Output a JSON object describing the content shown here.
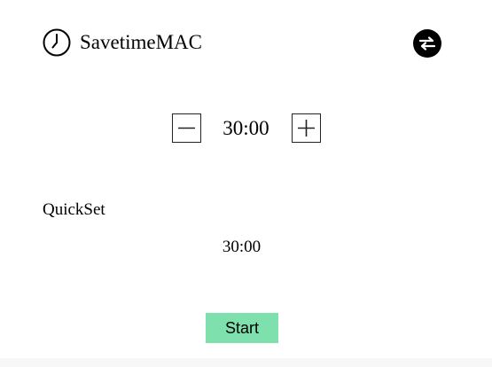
{
  "app": {
    "title": "SavetimeMAC",
    "logo_icon": "clock-icon",
    "swap_icon": "swap-arrows-icon"
  },
  "timer": {
    "value": "30:00",
    "decrement_icon": "minus-icon",
    "increment_icon": "plus-icon"
  },
  "quickset": {
    "label": "QuickSet",
    "items": [
      "30:00"
    ]
  },
  "actions": {
    "start_label": "Start"
  },
  "colors": {
    "start_button": "#7ee1ad",
    "text": "#000000",
    "background": "#ffffff"
  }
}
